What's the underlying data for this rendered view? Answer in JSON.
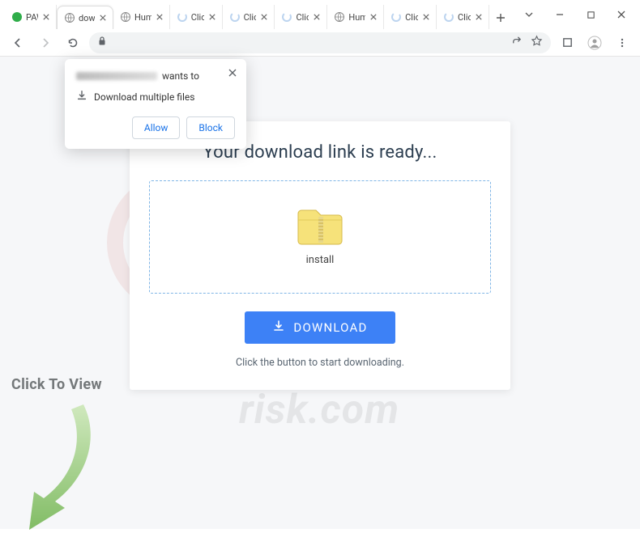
{
  "tabs": [
    {
      "label": "PAW",
      "favicon": "green"
    },
    {
      "label": "dowlo",
      "favicon": "globe",
      "active": true
    },
    {
      "label": "Huma",
      "favicon": "globe"
    },
    {
      "label": "Click",
      "favicon": "spin"
    },
    {
      "label": "Click",
      "favicon": "spin"
    },
    {
      "label": "Click",
      "favicon": "spin"
    },
    {
      "label": "Huma",
      "favicon": "globe"
    },
    {
      "label": "Click",
      "favicon": "spin"
    },
    {
      "label": "Click",
      "favicon": "spin"
    }
  ],
  "prompt": {
    "wants_to": "wants to",
    "message": "Download multiple files",
    "allow": "Allow",
    "block": "Block"
  },
  "card": {
    "heading": "Your download link is ready...",
    "file_label": "install",
    "button": "DOWNLOAD",
    "hint": "Click the button to start downloading."
  },
  "overlay": {
    "ctv": "Click To View"
  },
  "watermark": {
    "text": "risk.com"
  }
}
